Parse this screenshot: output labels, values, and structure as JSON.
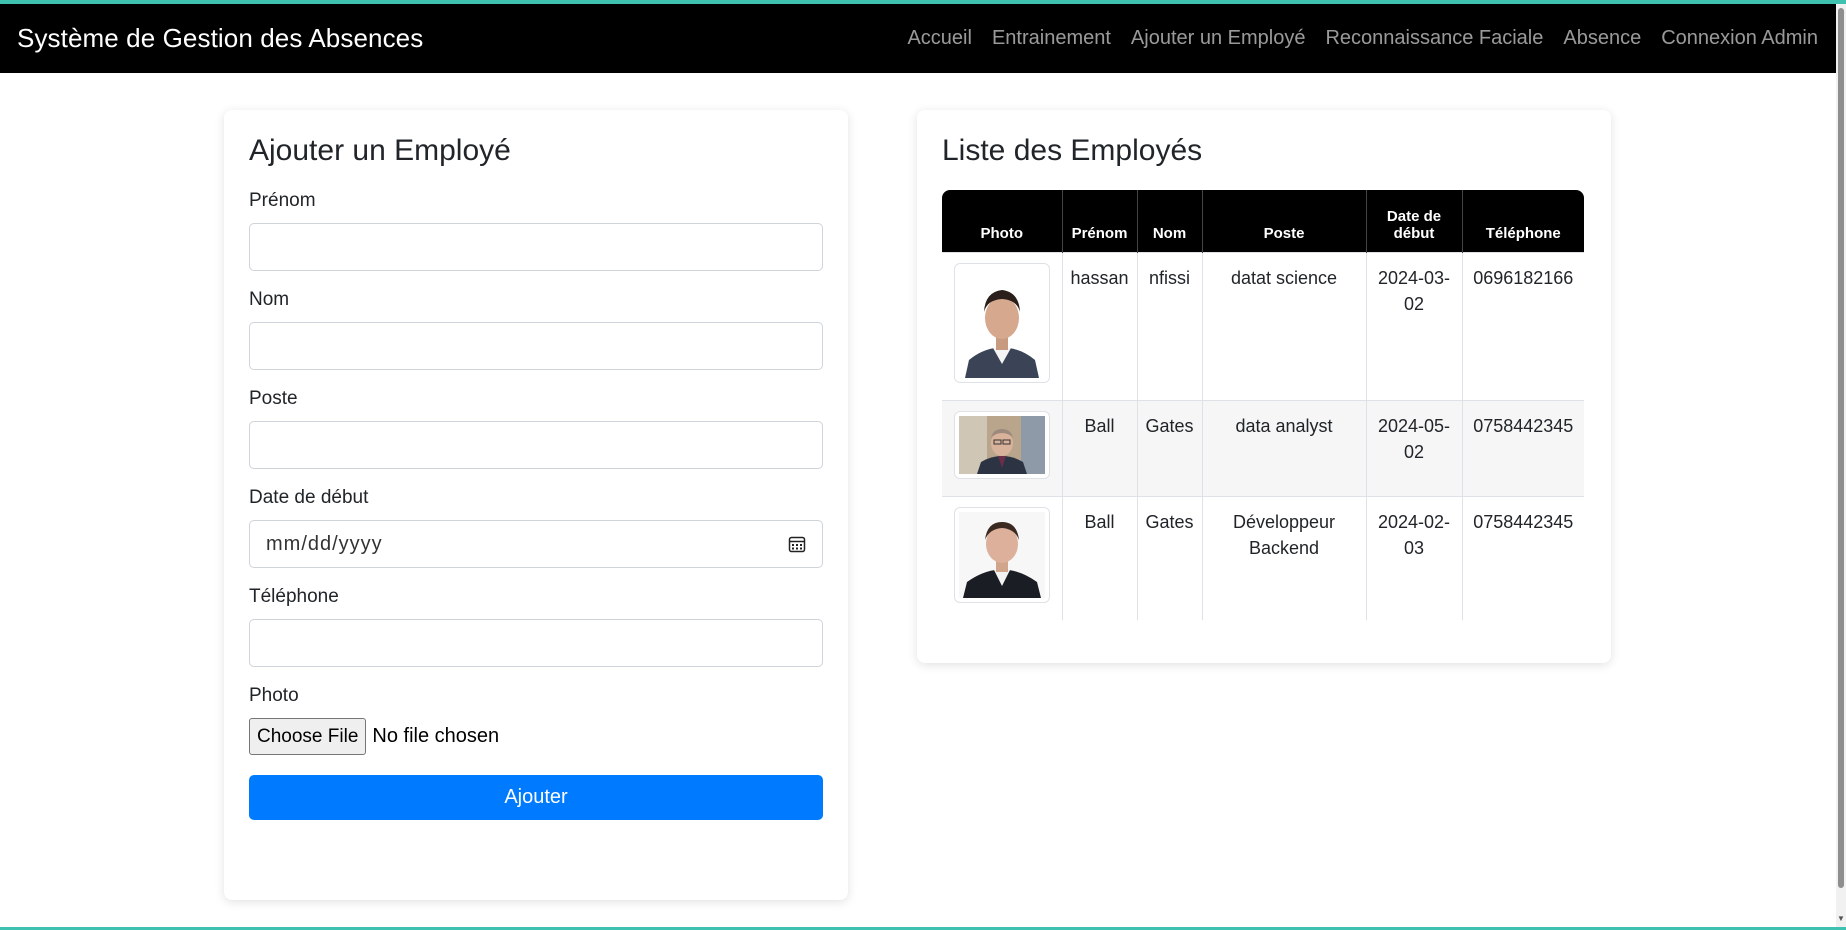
{
  "navbar": {
    "brand": "Système de Gestion des Absences",
    "links": [
      "Accueil",
      "Entrainement",
      "Ajouter un Employé",
      "Reconnaissance Faciale",
      "Absence",
      "Connexion Admin"
    ]
  },
  "form": {
    "title": "Ajouter un Employé",
    "fields": {
      "prenom_label": "Prénom",
      "nom_label": "Nom",
      "poste_label": "Poste",
      "date_label": "Date de début",
      "date_placeholder": "mm/dd/yyyy",
      "telephone_label": "Téléphone",
      "photo_label": "Photo"
    },
    "file_button": "Choose File",
    "file_status": "No file chosen",
    "submit": "Ajouter"
  },
  "list": {
    "title": "Liste des Employés",
    "columns": [
      "Photo",
      "Prénom",
      "Nom",
      "Poste",
      "Date de début",
      "Téléphone"
    ],
    "rows": [
      {
        "prenom": "hassan",
        "nom": "nfissi",
        "poste": "datat science",
        "date": "2024-03-02",
        "telephone": "0696182166",
        "photo": "portrait-young-man"
      },
      {
        "prenom": "Ball",
        "nom": "Gates",
        "poste": "data analyst",
        "date": "2024-05-02",
        "telephone": "0758442345",
        "photo": "portrait-man-glasses"
      },
      {
        "prenom": "Ball",
        "nom": "Gates",
        "poste": "Développeur Backend",
        "date": "2024-02-03",
        "telephone": "0758442345",
        "photo": "portrait-man-suit"
      }
    ]
  },
  "colors": {
    "navbar_bg": "#000000",
    "accent": "#3fc1b0",
    "primary_button": "#007bff"
  }
}
